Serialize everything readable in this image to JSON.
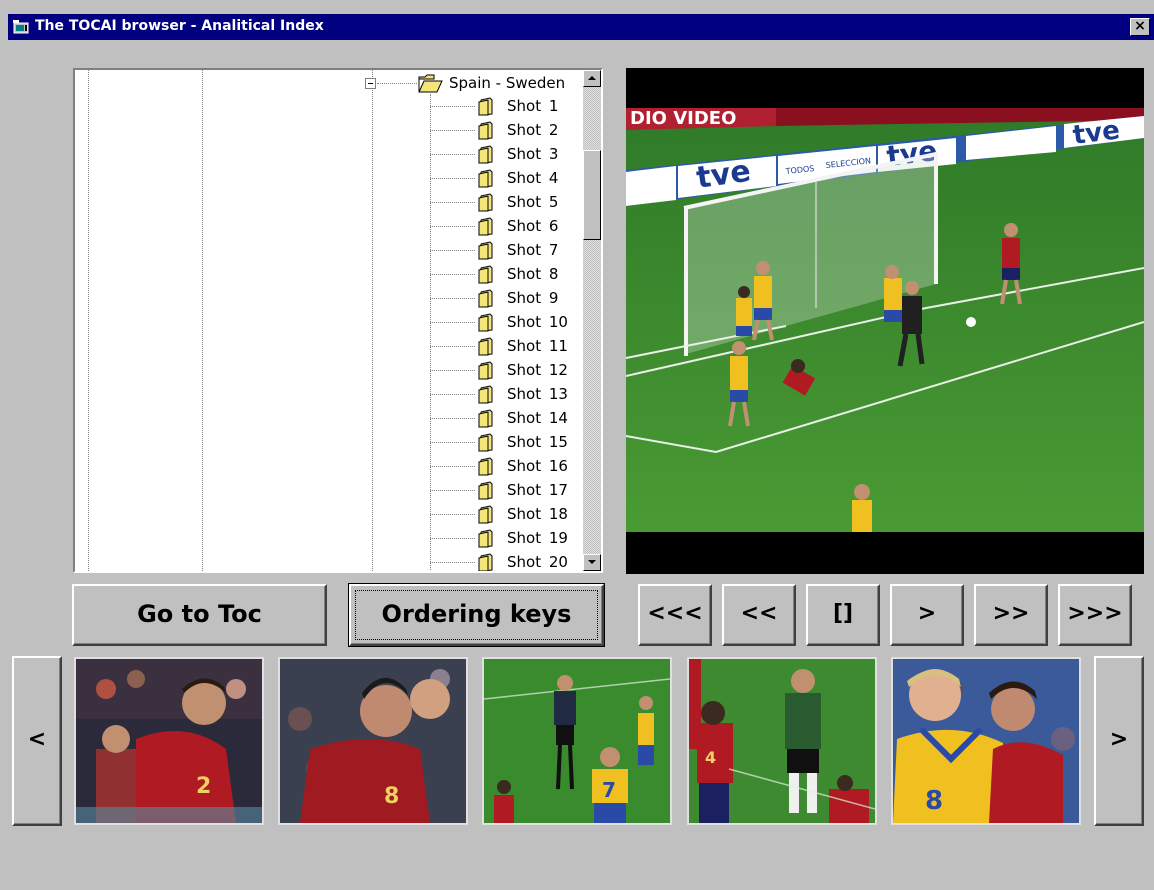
{
  "window": {
    "title": "The TOCAI browser - Analitical Index",
    "close_label": "×"
  },
  "tree": {
    "root_label": "Spain - Sweden",
    "items": [
      {
        "label": "Shot 1"
      },
      {
        "label": "Shot 2"
      },
      {
        "label": "Shot 3"
      },
      {
        "label": "Shot 4"
      },
      {
        "label": "Shot 5"
      },
      {
        "label": "Shot 6"
      },
      {
        "label": "Shot 7"
      },
      {
        "label": "Shot 8"
      },
      {
        "label": "Shot 9"
      },
      {
        "label": "Shot 10"
      },
      {
        "label": "Shot 11"
      },
      {
        "label": "Shot 12"
      },
      {
        "label": "Shot 13"
      },
      {
        "label": "Shot 14"
      },
      {
        "label": "Shot 15"
      },
      {
        "label": "Shot 16"
      },
      {
        "label": "Shot 17"
      },
      {
        "label": "Shot 18"
      },
      {
        "label": "Shot 19"
      },
      {
        "label": "Shot 20"
      }
    ]
  },
  "nav_buttons": {
    "goto_toc": "Go to Toc",
    "ordering_keys": "Ordering keys"
  },
  "media_controls": {
    "rewind_fast": "<<<",
    "rewind": "<<",
    "stop": "[]",
    "play": ">",
    "forward": ">>",
    "forward_fast": ">>>"
  },
  "filmstrip": {
    "prev": "<",
    "next": ">"
  },
  "video": {
    "ad_board_text": "tve",
    "ad_board_small": "SELECCION",
    "ad_board_todos": "TODOS",
    "top_banner": "DIO VIDEO"
  },
  "thumbnails": [
    {
      "jersey_number": "2"
    },
    {
      "jersey_number": "8"
    },
    {
      "jersey_number": "7"
    },
    {
      "jersey_number": "4"
    },
    {
      "jersey_number": "8"
    }
  ],
  "colors": {
    "titlebar": "#000080",
    "window_bg": "#c0c0c0",
    "pitch_green": "#3f8a2e",
    "spain_red": "#b01a22",
    "sweden_yellow": "#f0c020",
    "sweden_blue": "#2a4aa8",
    "folder_yellow": "#f2e67a"
  }
}
